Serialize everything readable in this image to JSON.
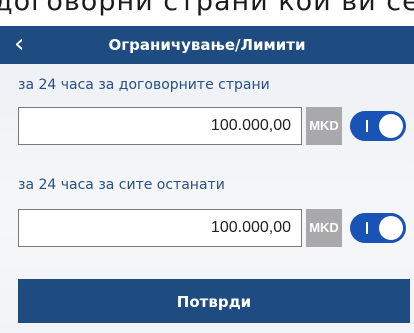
{
  "top_strip": {
    "text": "договорни страни кои ви се"
  },
  "header": {
    "back_icon": "chevron-left-icon",
    "title": "Ограничување/Лимити"
  },
  "limits": [
    {
      "label": "за 24 часа за договорните страни",
      "amount": "100.000,00",
      "currency": "MKD",
      "enabled": true
    },
    {
      "label": "за 24 часа за сите останати",
      "amount": "100.000,00",
      "currency": "MKD",
      "enabled": true
    }
  ],
  "confirm_button": {
    "label": "Потврди"
  },
  "colors": {
    "primary": "#1e4c80",
    "toggle_on": "#1953b5",
    "currency_badge": "#a9a9ab"
  }
}
